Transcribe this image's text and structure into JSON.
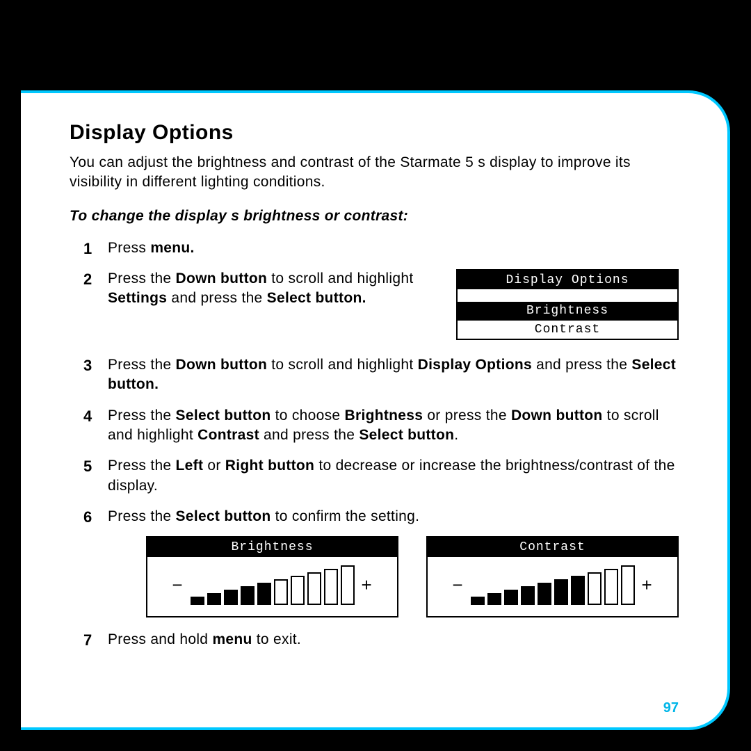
{
  "page": {
    "title": "Display Options",
    "intro": "You can adjust the brightness and contrast of the Starmate 5 s display to improve its visibility in different lighting conditions.",
    "subhead": "To change the display s brightness or contrast:",
    "number": "97"
  },
  "steps": {
    "s1_a": "Press ",
    "s1_b": "menu.",
    "s2_a": "Press the ",
    "s2_b": "Down button",
    "s2_c": " to scroll and highlight ",
    "s2_d": "Settings",
    "s2_e": " and press the ",
    "s2_f": "Select button.",
    "s3_a": "Press the ",
    "s3_b": "Down button",
    "s3_c": " to scroll and highlight ",
    "s3_d": "Display Options",
    "s3_e": " and press the ",
    "s3_f": "Select button.",
    "s4_a": "Press the ",
    "s4_b": "Select button",
    "s4_c": " to choose ",
    "s4_d": "Brightness",
    "s4_e": " or press the ",
    "s4_f": "Down button",
    "s4_g": " to scroll and highlight ",
    "s4_h": "Contrast",
    "s4_i": " and press the ",
    "s4_j": "Select button",
    "s4_k": ".",
    "s5_a": "Press the ",
    "s5_b": "Left",
    "s5_c": " or ",
    "s5_d": "Right button",
    "s5_e": " to decrease or increase the brightness/contrast of the display.",
    "s6_a": "Press the ",
    "s6_b": "Select button",
    "s6_c": " to confirm the setting.",
    "s7_a": "Press and hold ",
    "s7_b": "menu",
    "s7_c": " to exit."
  },
  "lcd_menu": {
    "title": "Display Options",
    "item_selected": "Brightness",
    "item2": "Contrast"
  },
  "gauge_brightness": {
    "title": "Brightness",
    "minus": "−",
    "plus": "+",
    "total_bars": 10,
    "filled_bars": 5
  },
  "gauge_contrast": {
    "title": "Contrast",
    "minus": "−",
    "plus": "+",
    "total_bars": 10,
    "filled_bars": 7
  }
}
